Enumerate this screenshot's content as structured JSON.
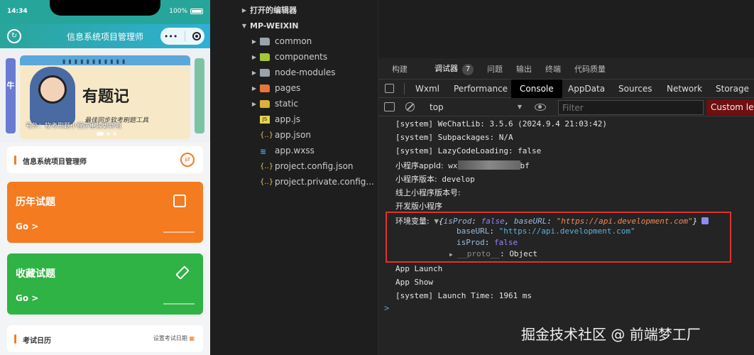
{
  "simulator": {
    "time": "14:34",
    "battery": "100%",
    "nav_title": "信息系统项目管理师",
    "capsule_more": "•••",
    "banner": {
      "headline": "有题记",
      "subtitle": "最佳同步软考刷题工具",
      "caption": "号外：软考刷题小程序重装更新啦",
      "side_text": "牛"
    },
    "section1": {
      "title": "信息系统项目管理师",
      "icon": "swap-icon"
    },
    "card1": {
      "title": "历年试题",
      "go": "Go >",
      "color": "#f47b20"
    },
    "card2": {
      "title": "收藏试题",
      "go": "Go >",
      "color": "#2fb344"
    },
    "section2": {
      "title": "考试日历",
      "action": "设置考试日期"
    }
  },
  "explorer": {
    "open_editors": "打开的编辑器",
    "project": "MP-WEIXIN",
    "items": [
      {
        "name": "common",
        "type": "folder"
      },
      {
        "name": "components",
        "type": "folder-g"
      },
      {
        "name": "node-modules",
        "type": "folder"
      },
      {
        "name": "pages",
        "type": "folder-o"
      },
      {
        "name": "static",
        "type": "folder-y"
      },
      {
        "name": "app.js",
        "type": "js"
      },
      {
        "name": "app.json",
        "type": "json"
      },
      {
        "name": "app.wxss",
        "type": "css"
      },
      {
        "name": "project.config.json",
        "type": "json"
      },
      {
        "name": "project.private.config...",
        "type": "json"
      }
    ]
  },
  "devtools": {
    "top_tabs": [
      "构建",
      "调试器",
      "问题",
      "输出",
      "终端",
      "代码质量"
    ],
    "debugger_badge": "7",
    "panel_tabs": [
      "Wxml",
      "Performance",
      "Console",
      "AppData",
      "Sources",
      "Network",
      "Storage"
    ],
    "active_panel": "Console",
    "context": "top",
    "filter_placeholder": "Filter",
    "levels": "Custom levels",
    "logs": {
      "l1": "[system] WeChatLib: 3.5.6 (2024.9.4 21:03:42)",
      "l2": "[system] Subpackages: N/A",
      "l3": "[system] LazyCodeLoading: false",
      "appid_label": "小程序appId:",
      "appid_prefix": "wx",
      "appid_suffix": "bf",
      "version_label": "小程序版本:",
      "version_value": "develop",
      "online_version": "线上小程序版本号:",
      "dev_version": "开发版小程序",
      "env_label": "环境变量:",
      "obj_open": "{",
      "isProd_key": "isProd",
      "isProd_val": "false",
      "baseURL_key": "baseURL",
      "baseURL_val": "\"https://api.development.com\"",
      "obj_close": "}",
      "proto_key": "__proto__",
      "proto_val": "Object",
      "launch": "App Launch",
      "show": "App Show",
      "launch_time": "[system] Launch Time: 1961 ms",
      "prompt": ">"
    }
  },
  "watermark": "掘金技术社区 @ 前端梦工厂"
}
